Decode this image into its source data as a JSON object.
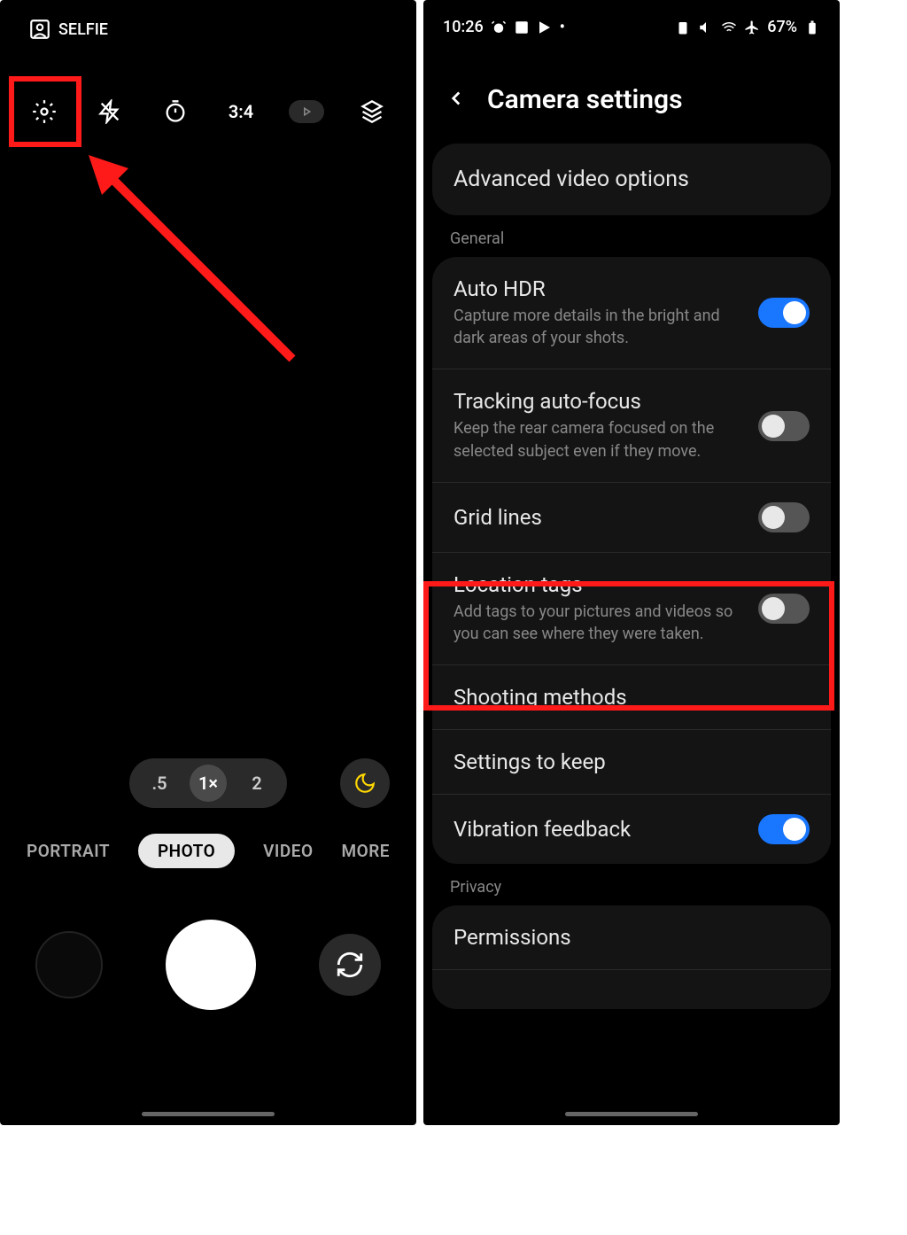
{
  "left": {
    "selfie_label": "SELFIE",
    "ratio": "3:4",
    "zoom": {
      "wide": ".5",
      "one": "1×",
      "two": "2"
    },
    "modes": {
      "portrait": "PORTRAIT",
      "photo": "PHOTO",
      "video": "VIDEO",
      "more": "MORE"
    }
  },
  "right": {
    "status": {
      "time": "10:26",
      "battery": "67%"
    },
    "title": "Camera settings",
    "adv_video": "Advanced video options",
    "section_general": "General",
    "auto_hdr": {
      "title": "Auto HDR",
      "desc": "Capture more details in the bright and dark areas of your shots."
    },
    "tracking": {
      "title": "Tracking auto-focus",
      "desc": "Keep the rear camera focused on the selected subject even if they move."
    },
    "grid": {
      "title": "Grid lines"
    },
    "location": {
      "title": "Location tags",
      "desc": "Add tags to your pictures and videos so you can see where they were taken."
    },
    "shooting": {
      "title": "Shooting methods"
    },
    "keep": {
      "title": "Settings to keep"
    },
    "vibration": {
      "title": "Vibration feedback"
    },
    "section_privacy": "Privacy",
    "permissions": "Permissions"
  }
}
